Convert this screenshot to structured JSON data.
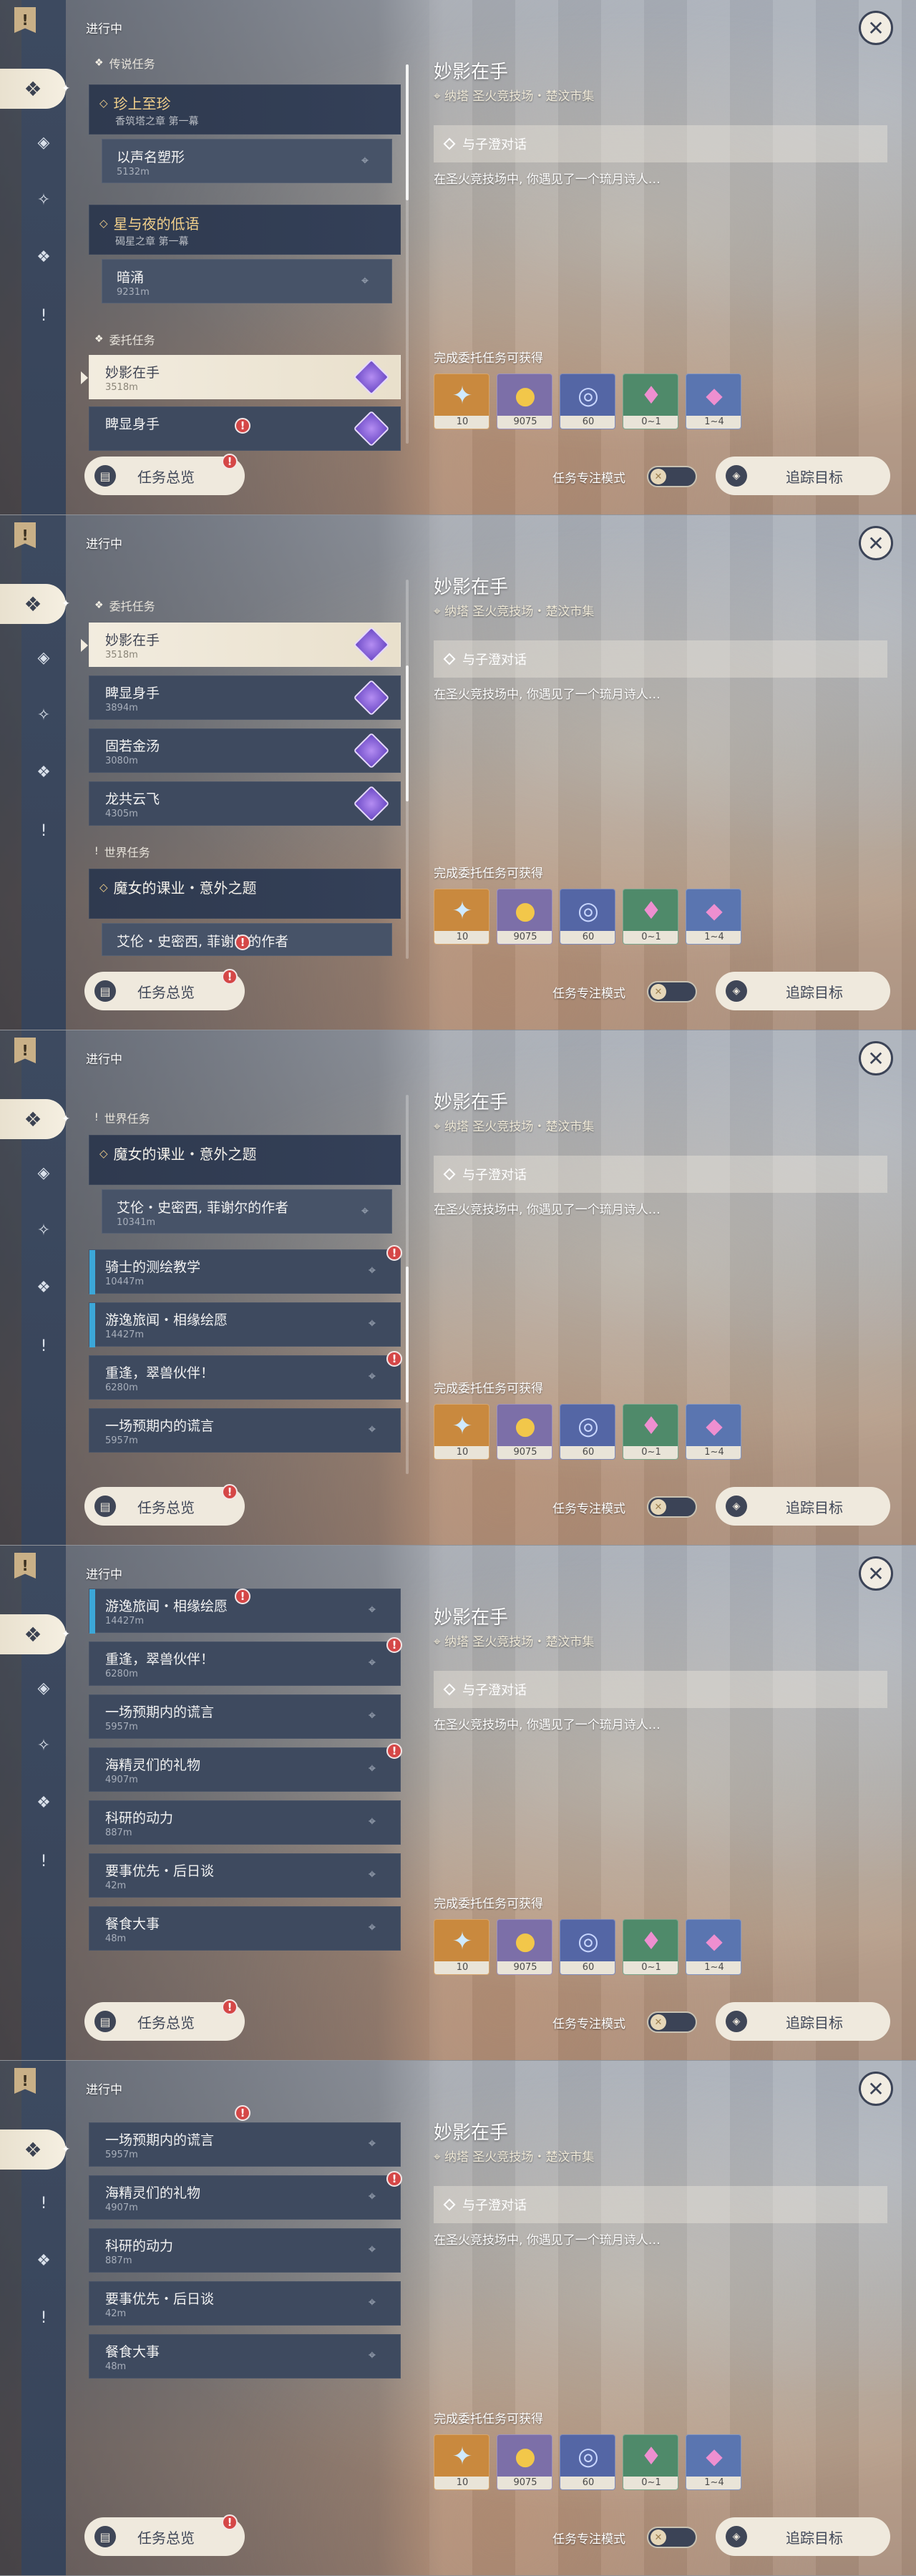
{
  "app": {
    "panel_title": "进行中",
    "overview_label": "任务总览",
    "focus_mode_label": "任务专注模式",
    "track_label": "追踪目标",
    "close_glyph": "✕"
  },
  "categories": {
    "legend": "传说任务",
    "commission": "委托任务",
    "world": "世界任务"
  },
  "legend_groups": [
    {
      "name": "珍上至珍",
      "sub": "香筑塔之章 第一幕",
      "step": "以声名塑形",
      "dist": "5132m"
    },
    {
      "name": "星与夜的低语",
      "sub": "碣星之章 第一幕",
      "step": "暗涌",
      "dist": "9231m"
    }
  ],
  "commissions": [
    {
      "name": "妙影在手",
      "dist": "3518m"
    },
    {
      "name": "睥显身手",
      "dist": "3894m"
    },
    {
      "name": "固若金汤",
      "dist": "3080m"
    },
    {
      "name": "龙共云飞",
      "dist": "4305m"
    }
  ],
  "world_group": {
    "name": "魔女的课业・意外之题",
    "step": "艾伦・史密西, 菲谢尔的作者",
    "dist": "10341m"
  },
  "world_items": [
    {
      "name": "骑士的测绘教学",
      "dist": "10447m"
    },
    {
      "name": "游逸旅闻・相缘绘愿",
      "dist": "14427m"
    },
    {
      "name": "重逢，翠兽伙伴！",
      "dist": "6280m"
    },
    {
      "name": "一场预期内的谎言",
      "dist": "5957m"
    },
    {
      "name": "海精灵们的礼物",
      "dist": "4907m"
    },
    {
      "name": "科研的动力",
      "dist": "887m"
    },
    {
      "name": "要事优先・后日谈",
      "dist": "42m"
    },
    {
      "name": "餐食大事",
      "dist": "48m"
    }
  ],
  "detail": {
    "title": "妙影在手",
    "location": "纳塔 圣火竞技场・楚汶市集",
    "step": "与子澄对话",
    "description": "在圣火竞技场中, 你遇见了一个琉月诗人…",
    "reward_label": "完成委托任务可获得",
    "rewards": [
      {
        "icon": "primogem-icon",
        "count": "10",
        "color": "#c9893e"
      },
      {
        "icon": "mora-icon",
        "count": "9075",
        "color": "#7c6fa8"
      },
      {
        "icon": "exp-icon",
        "count": "60",
        "color": "#5466a5"
      },
      {
        "icon": "crystal-icon",
        "count": "0~1",
        "color": "#4f8a6a"
      },
      {
        "icon": "crystal-cluster-icon",
        "count": "1~4",
        "color": "#5a75b0"
      }
    ]
  },
  "colors": {
    "legend_gold": "#f2d08b",
    "badge_red": "#d54747",
    "world_blue": "#3ca7d8",
    "selected_bg": "#f2ecdf"
  }
}
